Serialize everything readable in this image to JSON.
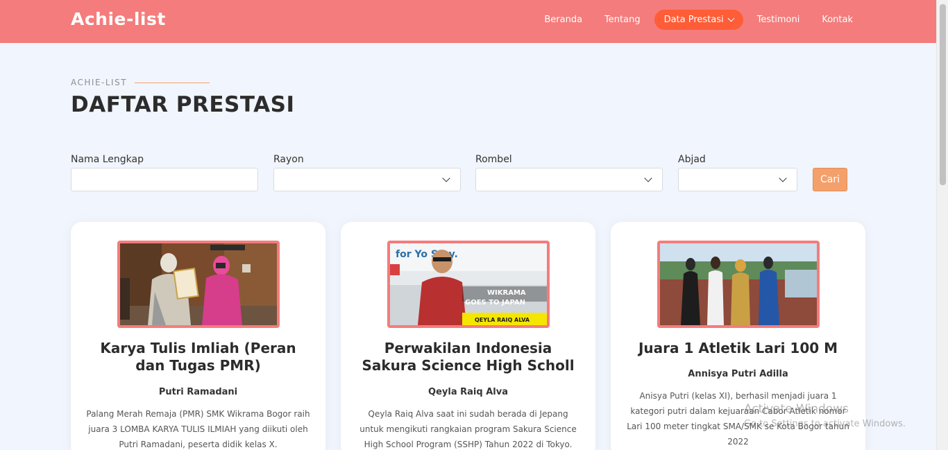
{
  "header": {
    "brand": "Achie-list",
    "nav": [
      "Beranda",
      "Tentang",
      "Data Prestasi",
      "Testimoni",
      "Kontak"
    ],
    "active_index": 2,
    "colors": {
      "bar": "#f47c7c",
      "active": "#fe5d38"
    }
  },
  "section": {
    "kicker": "ACHIE-LIST",
    "title": "DAFTAR PRESTASI"
  },
  "filters": {
    "nama_label": "Nama Lengkap",
    "nama_value": "",
    "rayon_label": "Rayon",
    "rayon_value": "",
    "rombel_label": "Rombel",
    "rombel_value": "",
    "abjad_label": "Abjad",
    "abjad_value": "",
    "search_label": "Cari"
  },
  "cards": [
    {
      "title": "Karya Tulis Imliah (Peran dan Tugas PMR)",
      "name": "Putri Ramadani",
      "desc": "Palang Merah Remaja (PMR) SMK Wikrama Bogor raih juara 3 LOMBA KARYA TULIS ILMIAH yang diikuti oleh Putri Ramadani, peserta didik kelas X.",
      "photo": "certificate-handover-photo"
    },
    {
      "title": "Perwakilan Indonesia Sakura Science High Scholl",
      "name": "Qeyla Raiq Alva",
      "desc": "Qeyla Raiq Alva saat ini sudah berada di Jepang untuk mengikuti rangkaian program Sakura Science High School Program (SSHP) Tahun 2022 di Tokyo.",
      "photo": "student-in-japan-photo",
      "photo_text": {
        "top": "for Yo Stay.",
        "banner1": "WIKRAMA",
        "banner2": "GOES TO JAPAN",
        "name_strip": "QEYLA RAIQ ALVA"
      }
    },
    {
      "title": "Juara 1 Atletik Lari 100 M",
      "name": "Annisya Putri Adilla",
      "desc": "Anisya Putri (kelas XI), berhasil menjadi juara 1 kategori putri dalam kejuaraan Cabor Atletik nomor Lari 100 meter tingkat SMA/SMK se Kota Bogor tahun 2022",
      "photo": "athletics-medal-photo"
    }
  ],
  "watermark": {
    "line1": "Activate Windows",
    "line2": "Go to Settings to activate Windows."
  }
}
